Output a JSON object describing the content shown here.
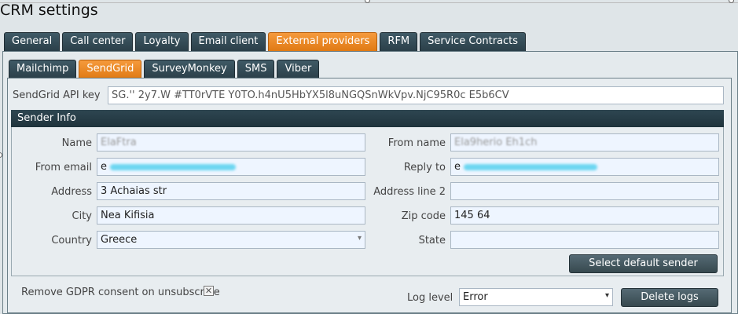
{
  "window": {
    "title": "CRM settings"
  },
  "main_tabs": [
    "General",
    "Call center",
    "Loyalty",
    "Email client",
    "External providers",
    "RFM",
    "Service Contracts"
  ],
  "sub_tabs": [
    "Mailchimp",
    "SendGrid",
    "SurveyMonkey",
    "SMS",
    "Viber"
  ],
  "api": {
    "label": "SendGrid API key",
    "value": "SG.'' 2y7.W #TT0rVTE   Y0TO.h4nU5HbYX5l8uNGQSnWkVpv.NjC95R0c   E5b6CV"
  },
  "sender": {
    "header": "Sender Info",
    "name_label": "Name",
    "name_value": "ElaFtra",
    "from_name_label": "From name",
    "from_name_value": "Ela9herio Eh1ch",
    "from_email_label": "From email",
    "from_email_value": "e",
    "reply_to_label": "Reply to",
    "reply_to_value": "e",
    "address_label": "Address",
    "address_value": "3  Achaias str",
    "address2_label": "Address line 2",
    "address2_value": "",
    "city_label": "City",
    "city_value": "Nea Kifisia",
    "zip_label": "Zip code",
    "zip_value": "145 64",
    "country_label": "Country",
    "country_value": "Greece",
    "state_label": "State",
    "state_value": "",
    "select_default_label": "Select default sender"
  },
  "footer": {
    "gdpr_label": "Remove GDPR consent on unsubscribe",
    "gdpr_checked_glyph": "✕",
    "log_level_label": "Log level",
    "log_level_value": "Error",
    "delete_logs_label": "Delete logs"
  },
  "colors": {
    "active_tab": "#e8841f",
    "tab": "#34505c",
    "field_bg": "#eef5ff",
    "header_bg": "#27404a"
  }
}
